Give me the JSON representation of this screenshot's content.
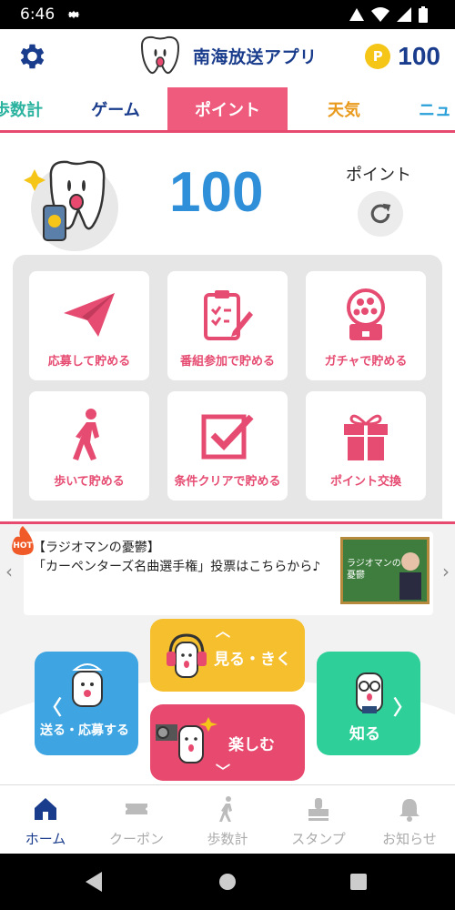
{
  "status_bar": {
    "time": "6:46"
  },
  "header": {
    "app_title": "南海放送アプリ",
    "points": "100",
    "coin_letter": "P"
  },
  "tabs": [
    {
      "label": "歩数計"
    },
    {
      "label": "ゲーム"
    },
    {
      "label": "ポイント"
    },
    {
      "label": "天気"
    },
    {
      "label": "ニュ"
    }
  ],
  "hero": {
    "points_value": "100",
    "points_label": "ポイント"
  },
  "grid": [
    {
      "label": "応募して貯める",
      "icon": "paper-plane-icon"
    },
    {
      "label": "番組参加で貯める",
      "icon": "clipboard-pen-icon"
    },
    {
      "label": "ガチャで貯める",
      "icon": "gacha-machine-icon"
    },
    {
      "label": "歩いて貯める",
      "icon": "walking-person-icon"
    },
    {
      "label": "条件クリアで貯める",
      "icon": "checkbox-icon"
    },
    {
      "label": "ポイント交換",
      "icon": "gift-icon"
    }
  ],
  "news": {
    "badge": "HOT",
    "text": "【ラジオマンの憂鬱】\n「カーペンターズ名曲選手権」投票はこちらから♪",
    "thumb_text": "ラジオマンの憂鬱"
  },
  "main_buttons": {
    "send": "送る・応募する",
    "see": "見る・きく",
    "fun": "楽しむ",
    "know": "知る"
  },
  "bottom_nav": [
    {
      "label": "ホーム",
      "active": true
    },
    {
      "label": "クーポン"
    },
    {
      "label": "歩数計"
    },
    {
      "label": "スタンプ"
    },
    {
      "label": "お知らせ"
    }
  ],
  "colors": {
    "accent_pink": "#e84a6f",
    "navy": "#1a3c8c",
    "points_blue": "#2f8fd8"
  }
}
